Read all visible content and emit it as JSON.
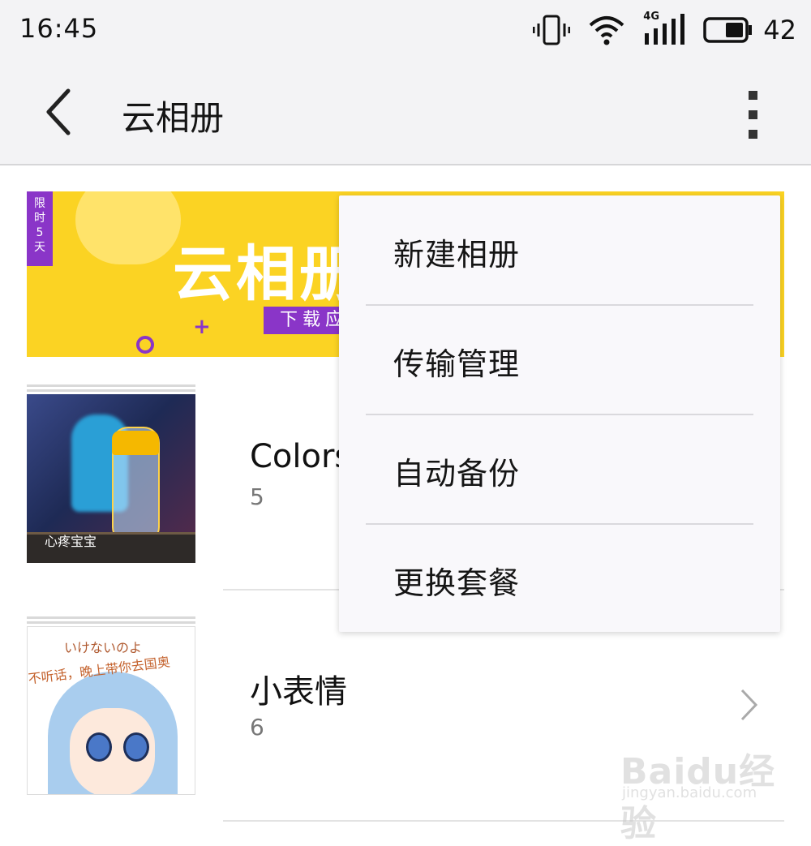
{
  "status_bar": {
    "time": "16:45",
    "network": "4G",
    "battery": "42",
    "icons": [
      "vibrate-icon",
      "wifi-icon",
      "cellular-signal-icon",
      "battery-icon"
    ]
  },
  "app_bar": {
    "title": "云相册",
    "back_icon": "chevron-left-icon",
    "more_icon": "more-vertical-icon"
  },
  "banner": {
    "badge": [
      "限",
      "时",
      "5",
      "天"
    ],
    "headline": "云相册",
    "button_text": "下载应"
  },
  "albums": [
    {
      "name": "Colors",
      "count": "5",
      "thumb_caption": "心疼宝宝"
    },
    {
      "name": "小表情",
      "count": "6",
      "thumb_caption_1": "いけないのよ",
      "thumb_caption_2": "不听话，晚上带你去国奥"
    }
  ],
  "menu": {
    "items": [
      {
        "label": "新建相册"
      },
      {
        "label": "传输管理"
      },
      {
        "label": "自动备份"
      },
      {
        "label": "更换套餐"
      }
    ]
  },
  "watermark": {
    "brand": "Baidu经验",
    "url": "jingyan.baidu.com"
  },
  "colors": {
    "accent_purple": "#8a35c8",
    "banner_yellow": "#fbd323",
    "bar_bg": "#f3f3f5"
  }
}
